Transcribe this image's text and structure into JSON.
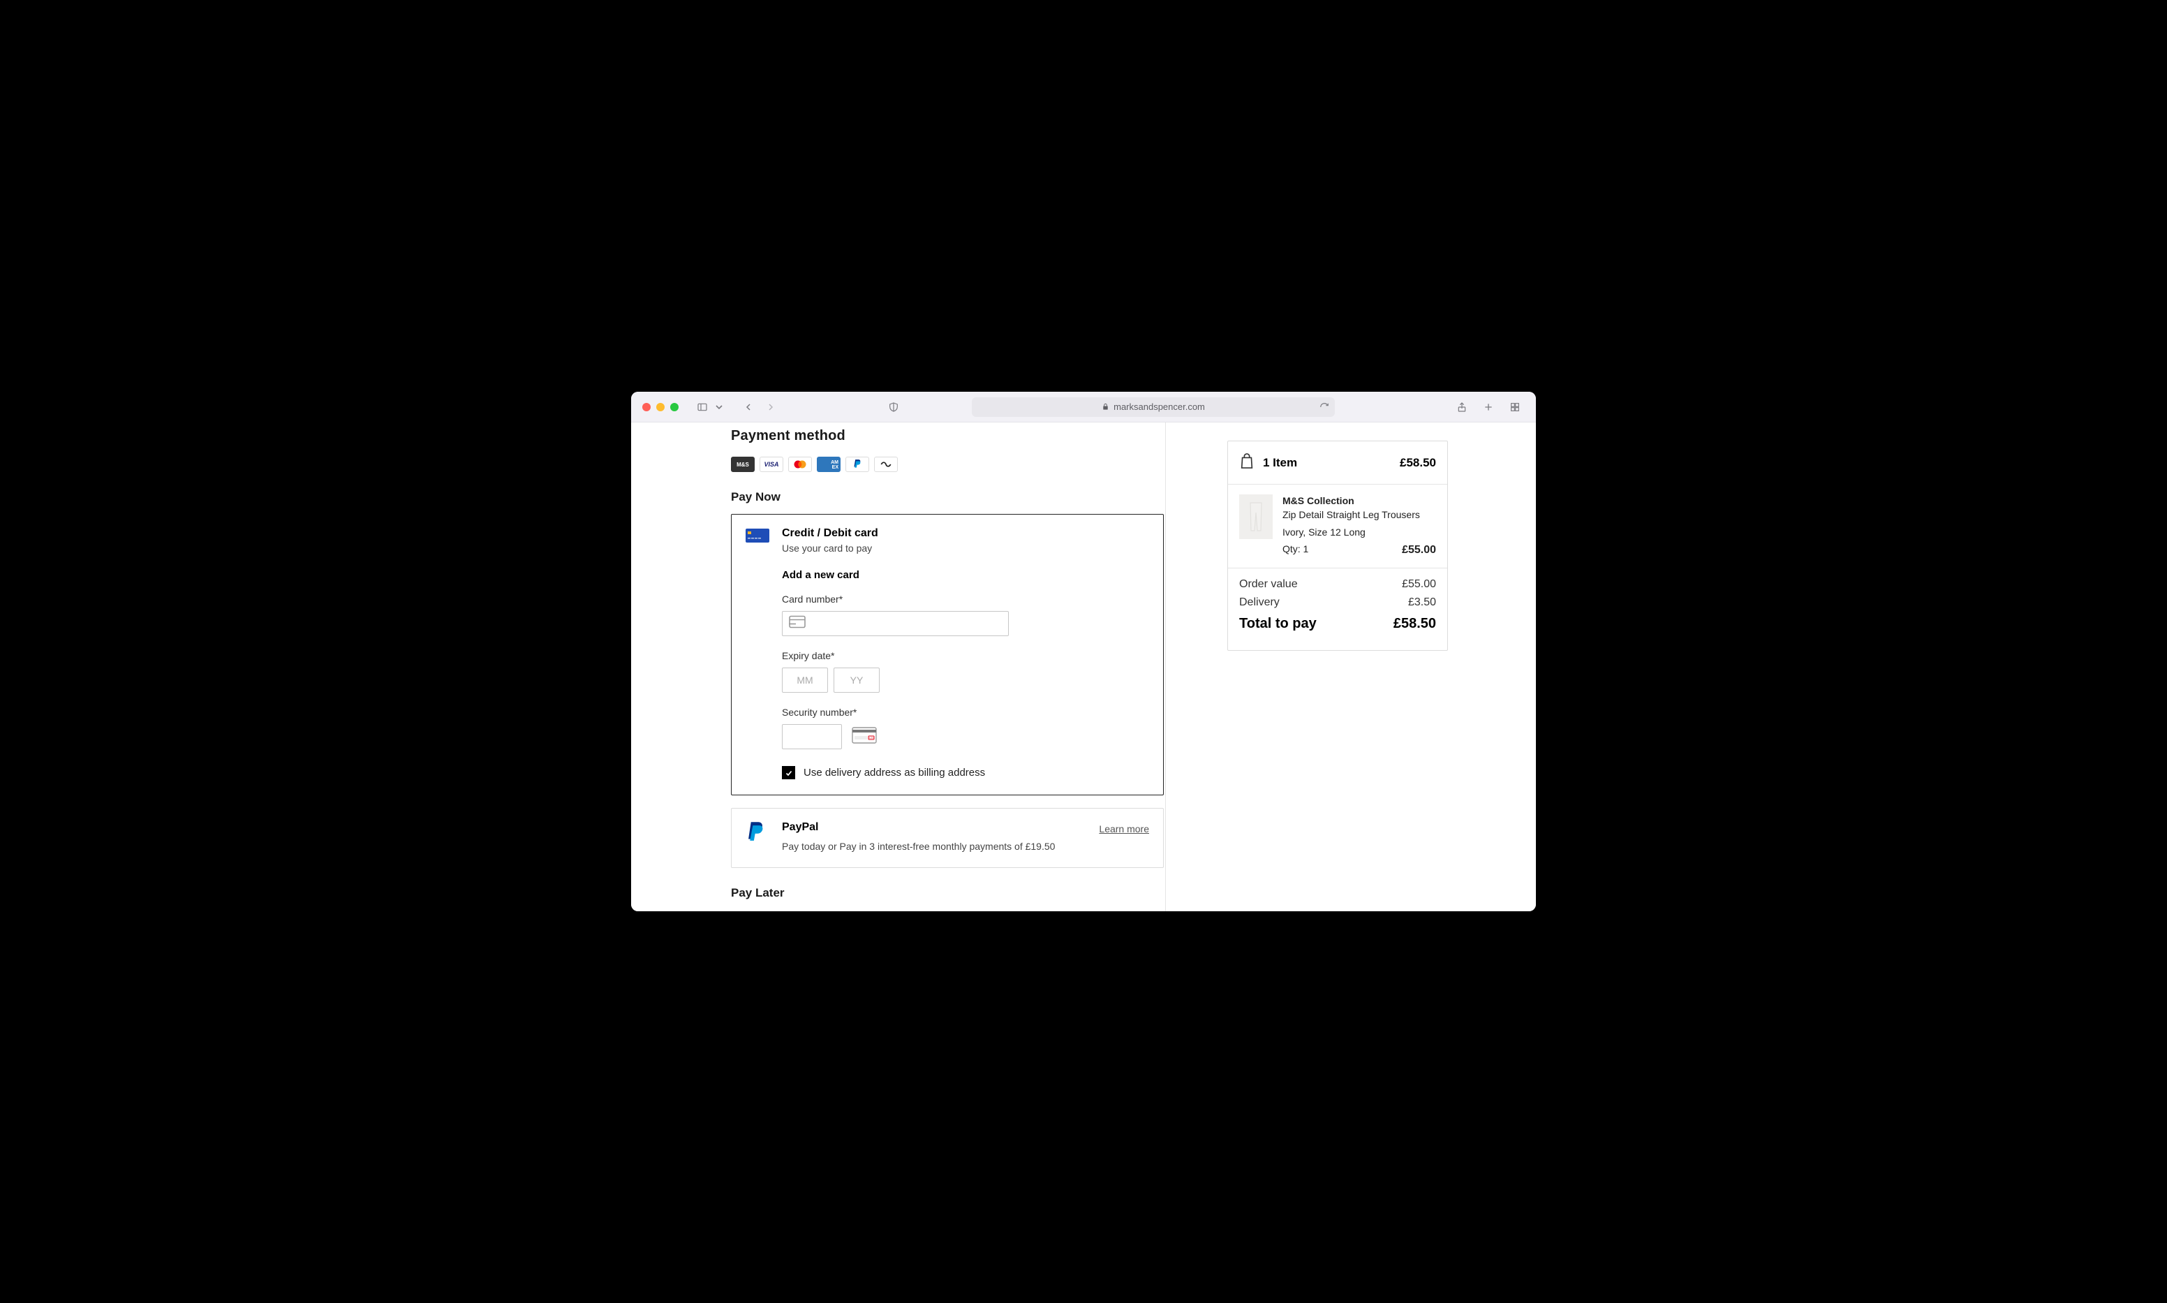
{
  "browser": {
    "url": "marksandspencer.com"
  },
  "payment": {
    "heading": "Payment method",
    "pay_now_heading": "Pay Now",
    "pay_later_heading": "Pay Later",
    "icons": {
      "ms": "M&S",
      "visa": "VISA",
      "amex": "AM\nEX"
    },
    "card_option": {
      "title": "Credit / Debit card",
      "desc": "Use your card to pay",
      "form": {
        "heading": "Add a new card",
        "card_number_label": "Card number*",
        "expiry_label": "Expiry date*",
        "mm_placeholder": "MM",
        "yy_placeholder": "YY",
        "security_label": "Security number*",
        "billing_checkbox_label": "Use delivery address as billing address"
      }
    },
    "paypal_option": {
      "title": "PayPal",
      "learn_more": "Learn more",
      "desc": "Pay today or Pay in 3 interest-free monthly payments of £19.50"
    }
  },
  "summary": {
    "header_text": "1 Item",
    "header_price": "£58.50",
    "item": {
      "brand": "M&S Collection",
      "name": "Zip Detail Straight Leg Trousers",
      "variant": "Ivory, Size 12 Long",
      "qty": "Qty: 1",
      "price": "£55.00"
    },
    "order_value_label": "Order value",
    "order_value": "£55.00",
    "delivery_label": "Delivery",
    "delivery": "£3.50",
    "total_label": "Total to pay",
    "total": "£58.50"
  }
}
